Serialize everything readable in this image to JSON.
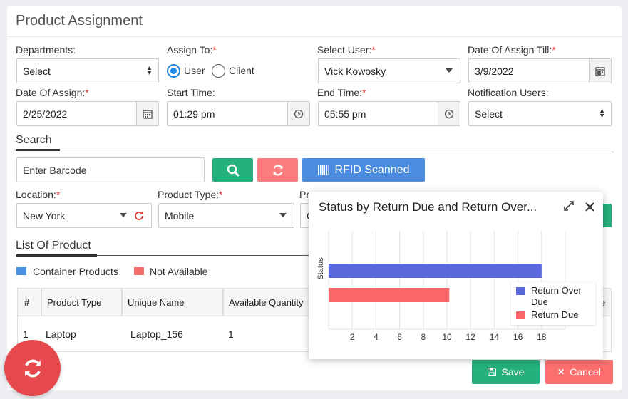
{
  "page": {
    "title": "Product Assignment"
  },
  "form": {
    "departments": {
      "label": "Departments:",
      "value": "Select"
    },
    "assign_to": {
      "label": "Assign To:",
      "required": "*",
      "options": [
        "User",
        "Client"
      ],
      "selected": "User"
    },
    "select_user": {
      "label": "Select User:",
      "required": "*",
      "value": "Vick Kowosky"
    },
    "date_assign_till": {
      "label": "Date Of Assign Till:",
      "required": "*",
      "value": "3/9/2022"
    },
    "date_of_assign": {
      "label": "Date Of Assign:",
      "required": "*",
      "value": "2/25/2022"
    },
    "start_time": {
      "label": "Start Time:",
      "value": "01:29 pm"
    },
    "end_time": {
      "label": "End Time:",
      "required": "*",
      "value": "05:55 pm"
    },
    "notification_users": {
      "label": "Notification Users:",
      "value": "Select"
    }
  },
  "search": {
    "title": "Search",
    "barcode_placeholder": "Enter Barcode",
    "rfid_label": "RFID Scanned",
    "location": {
      "label": "Location:",
      "required": "*",
      "value": "New York"
    },
    "product_type": {
      "label": "Product Type:",
      "required": "*",
      "value": "Mobile"
    },
    "partial_label": "Pr",
    "partial_value": "C"
  },
  "list": {
    "title": "List Of Product",
    "legend": [
      {
        "label": "Container Products",
        "color": "#4a90e2"
      },
      {
        "label": "Not Available",
        "color": "#f56c6c"
      }
    ],
    "columns": [
      "#",
      "Product Type",
      "Unique Name",
      "Available Quantity"
    ],
    "partial_column": "e",
    "rows": [
      {
        "num": "1",
        "type": "Laptop",
        "name": "Laptop_156",
        "qty": "1"
      }
    ]
  },
  "actions": {
    "save_label": "Save",
    "cancel_label": "Cancel"
  },
  "colors": {
    "accent": "#1e88e5",
    "green": "#26b07d",
    "red": "#fb6f6f",
    "blue": "#4a8cdf",
    "fab": "#e5484d"
  },
  "popup": {
    "title": "Status by Return Due and Return Over..."
  },
  "chart_data": {
    "type": "bar",
    "orientation": "horizontal",
    "ylabel": "Status",
    "xlim": [
      0,
      20
    ],
    "xticks": [
      2,
      4,
      6,
      8,
      10,
      12,
      14,
      16,
      18
    ],
    "grid": true,
    "legend_position": "right",
    "series": [
      {
        "name": "Return Over Due",
        "value": 18,
        "color": "#5b67dd"
      },
      {
        "name": "Return Due",
        "value": 10.2,
        "color": "#f9676b"
      }
    ]
  }
}
